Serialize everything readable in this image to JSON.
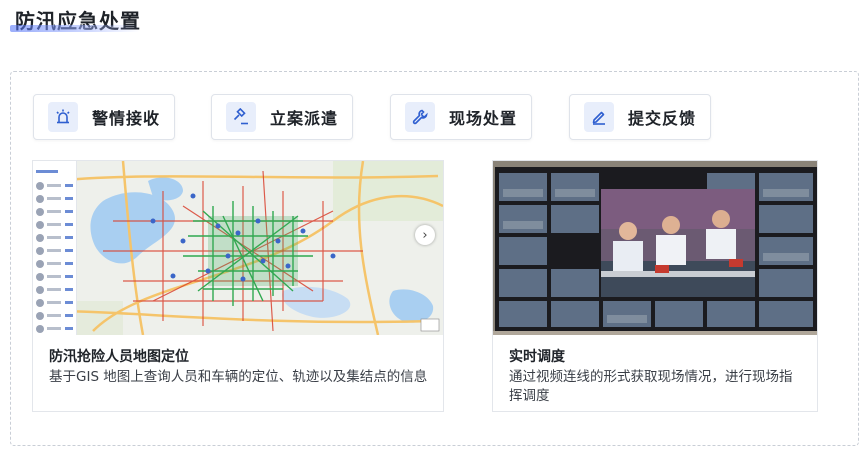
{
  "page": {
    "title": "防汛应急处置"
  },
  "steps": [
    {
      "label": "警情接收",
      "icon": "alarm-light-icon"
    },
    {
      "label": "立案派遣",
      "icon": "gavel-icon"
    },
    {
      "label": "现场处置",
      "icon": "wrench-icon"
    },
    {
      "label": "提交反馈",
      "icon": "edit-pen-icon"
    }
  ],
  "cards": [
    {
      "title": "防汛抢险人员地图定位",
      "description": "基于GIS 地图上查询人员和车辆的定位、轨迹以及集结点的信息",
      "media": "map-image"
    },
    {
      "title": "实时调度",
      "description": "通过视频连线的形式获取现场情况，进行现场指挥调度",
      "media": "video-conference-image"
    }
  ],
  "colors": {
    "accent": "#2f5fd0",
    "icon_bg": "#e8eefb",
    "border": "#dfe3ea"
  }
}
